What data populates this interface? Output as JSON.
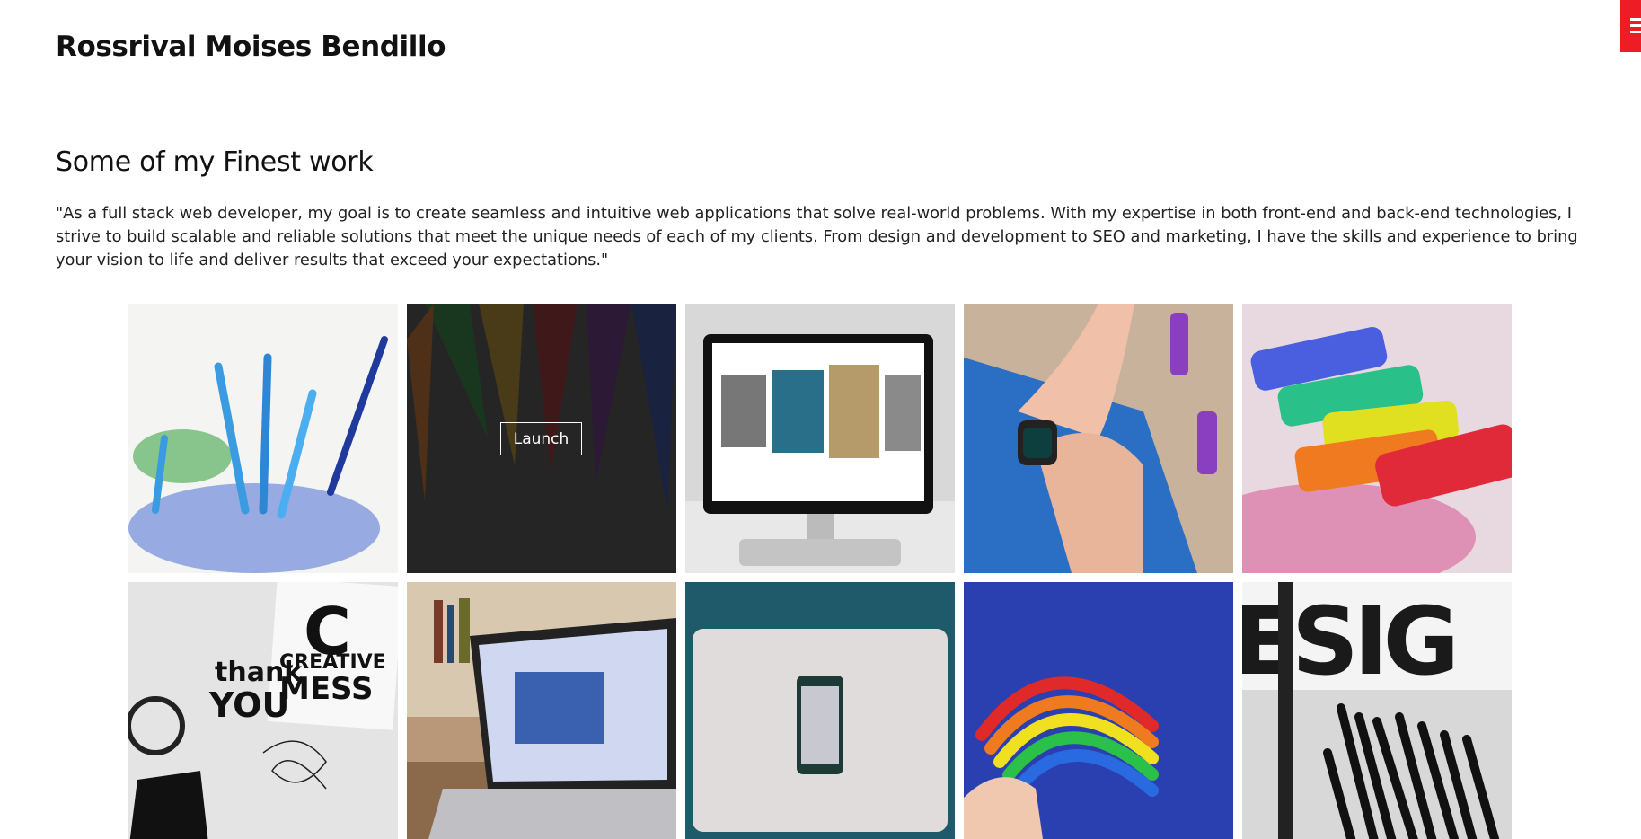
{
  "header": {
    "site_title": "Rossrival Moises Bendillo",
    "menu_icon": "hamburger-menu-icon",
    "accent_color": "#ee1c25"
  },
  "portfolio": {
    "heading": "Some of my Finest work",
    "intro": "\"As a full stack web developer, my goal is to create seamless and intuitive web applications that solve real-world problems. With my expertise in both front-end and back-end technologies, I strive to build scalable and reliable solutions that meet the unique needs of each of my clients. From design and development to SEO and marketing, I have the skills and experience to bring your vision to life and deliver results that exceed your expectations.\"",
    "launch_label": "Launch",
    "items": [
      {
        "name": "blue-pencils"
      },
      {
        "name": "colored-pencils-dark"
      },
      {
        "name": "desktop-monitor"
      },
      {
        "name": "smartwatch-wrist"
      },
      {
        "name": "colored-chalk"
      },
      {
        "name": "creative-mess-posters"
      },
      {
        "name": "laptop-bookshelf"
      },
      {
        "name": "laptop-phone-teal"
      },
      {
        "name": "rainbow-clay"
      },
      {
        "name": "design-black-pencils"
      }
    ],
    "poster_text": {
      "big_c": "C",
      "creative": "CREATIVE",
      "mess": "MESS",
      "thank": "thank",
      "you": "YOU",
      "design_word": "ESIG"
    }
  }
}
